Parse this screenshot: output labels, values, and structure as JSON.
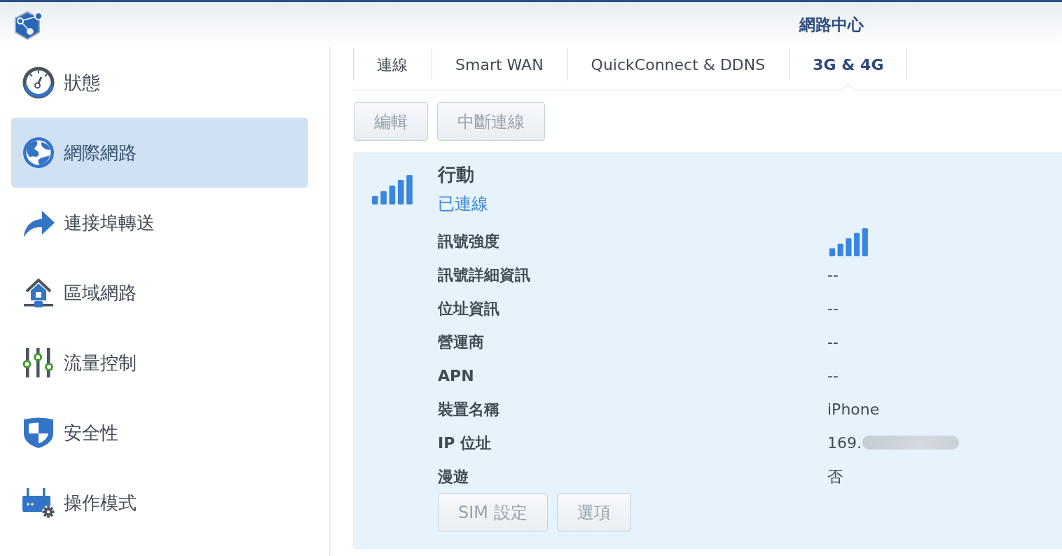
{
  "window": {
    "title": "網路中心"
  },
  "sidebar": {
    "items": [
      {
        "label": "狀態",
        "selected": false
      },
      {
        "label": "網際網路",
        "selected": true
      },
      {
        "label": "連接埠轉送",
        "selected": false
      },
      {
        "label": "區域網路",
        "selected": false
      },
      {
        "label": "流量控制",
        "selected": false
      },
      {
        "label": "安全性",
        "selected": false
      },
      {
        "label": "操作模式",
        "selected": false
      }
    ]
  },
  "tabs": [
    {
      "label": "連線",
      "selected": false
    },
    {
      "label": "Smart WAN",
      "selected": false
    },
    {
      "label": "QuickConnect & DDNS",
      "selected": false
    },
    {
      "label": "3G & 4G",
      "selected": true
    }
  ],
  "toolbar": {
    "buttons": [
      {
        "label": "編輯",
        "disabled": true
      },
      {
        "label": "中斷連線",
        "disabled": true
      }
    ]
  },
  "mobile_connection": {
    "title": "行動",
    "status": "已連線",
    "rows": [
      {
        "kind": "signal",
        "label": "訊號強度"
      },
      {
        "kind": "text",
        "label": "訊號詳細資訊",
        "value": "--",
        "blurred": false
      },
      {
        "kind": "text",
        "label": "位址資訊",
        "value": "--",
        "blurred": false
      },
      {
        "kind": "text",
        "label": "營運商",
        "value": "--",
        "blurred": false
      },
      {
        "kind": "text",
        "label": "APN",
        "value": "--",
        "blurred": false
      },
      {
        "kind": "text",
        "label": "裝置名稱",
        "value": "iPhone",
        "blurred": false
      },
      {
        "kind": "text",
        "label": "IP 位址",
        "value": "169.",
        "blurred": true
      },
      {
        "kind": "text",
        "label": "漫遊",
        "value": "否",
        "blurred": false
      }
    ],
    "buttons": [
      {
        "label": "SIM 設定",
        "disabled": true
      },
      {
        "label": "選項",
        "disabled": true
      }
    ]
  }
}
